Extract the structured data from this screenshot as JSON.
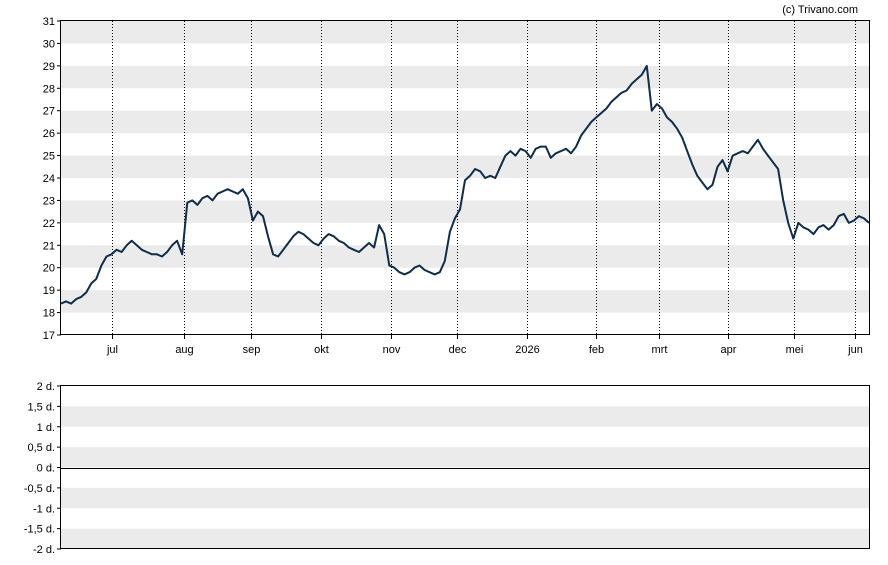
{
  "copyright": "(c) Trivano.com",
  "chart_data": [
    {
      "type": "line",
      "title": "",
      "xlabel": "",
      "ylabel": "",
      "ylim": [
        17,
        31
      ],
      "yticks": [
        "17",
        "18",
        "19",
        "20",
        "21",
        "22",
        "23",
        "24",
        "25",
        "26",
        "27",
        "28",
        "29",
        "30",
        "31"
      ],
      "xticks": [
        "jul",
        "aug",
        "sep",
        "okt",
        "nov",
        "dec",
        "2026",
        "feb",
        "mrt",
        "apr",
        "mei",
        "jun"
      ],
      "grid": "alternating horizontal bands, dotted vertical month lines",
      "line_color": "#0f2d4a",
      "band_color": "#ebebeb",
      "series": [
        {
          "values": [
            18.4,
            18.5,
            18.4,
            18.6,
            18.7,
            18.9,
            19.3,
            19.5,
            20.1,
            20.5,
            20.6,
            20.8,
            20.7,
            21.0,
            21.2,
            21.0,
            20.8,
            20.7,
            20.6,
            20.6,
            20.5,
            20.7,
            21.0,
            21.2,
            20.6,
            22.9,
            23.0,
            22.8,
            23.1,
            23.2,
            23.0,
            23.3,
            23.4,
            23.5,
            23.4,
            23.3,
            23.5,
            23.1,
            22.1,
            22.5,
            22.3,
            21.4,
            20.6,
            20.5,
            20.8,
            21.1,
            21.4,
            21.6,
            21.5,
            21.3,
            21.1,
            21.0,
            21.3,
            21.5,
            21.4,
            21.2,
            21.1,
            20.9,
            20.8,
            20.7,
            20.9,
            21.1,
            20.9,
            21.9,
            21.5,
            20.1,
            20.0,
            19.8,
            19.7,
            19.8,
            20.0,
            20.1,
            19.9,
            19.8,
            19.7,
            19.8,
            20.3,
            21.6,
            22.2,
            22.6,
            23.9,
            24.1,
            24.4,
            24.3,
            24.0,
            24.1,
            24.0,
            24.5,
            25.0,
            25.2,
            25.0,
            25.3,
            25.2,
            24.9,
            25.3,
            25.4,
            25.4,
            24.9,
            25.1,
            25.2,
            25.3,
            25.1,
            25.4,
            25.9,
            26.2,
            26.5,
            26.7,
            26.9,
            27.1,
            27.4,
            27.6,
            27.8,
            27.9,
            28.2,
            28.4,
            28.6,
            29.0,
            27.0,
            27.3,
            27.1,
            26.7,
            26.5,
            26.2,
            25.8,
            25.2,
            24.6,
            24.1,
            23.8,
            23.5,
            23.7,
            24.5,
            24.8,
            24.3,
            25.0,
            25.1,
            25.2,
            25.1,
            25.4,
            25.7,
            25.3,
            25.0,
            24.7,
            24.4,
            23.0,
            22.0,
            21.3,
            22.0,
            21.8,
            21.7,
            21.5,
            21.8,
            21.9,
            21.7,
            21.9,
            22.3,
            22.4,
            22.0,
            22.1,
            22.3,
            22.2,
            22.0
          ]
        }
      ]
    },
    {
      "type": "line",
      "title": "",
      "xlabel": "",
      "ylabel": "",
      "ylim": [
        -2,
        2
      ],
      "yticks": [
        "2 d.",
        "1,5 d.",
        "1 d.",
        "0,5 d.",
        "0 d.",
        "-0,5 d.",
        "-1 d.",
        "-1,5 d.",
        "-2 d."
      ],
      "grid": "alternating horizontal bands",
      "line_color": "#000000",
      "band_color": "#ebebeb",
      "series": [
        {
          "values": [
            0,
            0
          ]
        }
      ]
    }
  ]
}
